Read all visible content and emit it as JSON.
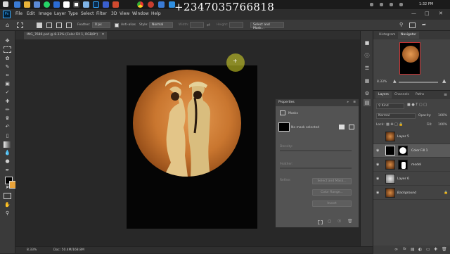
{
  "phone_overlay": "+2347035766818",
  "taskbar": {
    "time": "1:32 PM"
  },
  "menu": [
    "File",
    "Edit",
    "Image",
    "Layer",
    "Type",
    "Select",
    "Filter",
    "3D",
    "View",
    "Window",
    "Help"
  ],
  "options": {
    "feather_label": "Feather:",
    "feather_value": "0 px",
    "antialias": "Anti-alias",
    "style_label": "Style:",
    "style_value": "Normal",
    "width_label": "Width:",
    "height_label": "Height:",
    "select_mask": "Select and Mask..."
  },
  "document": {
    "tab_title": "IMG_7686.psd @ 8.33% (Color Fill 1, RGB/8*)",
    "zoom": "8.33%",
    "doc_info": "Doc: 50.4M/168.8M"
  },
  "properties": {
    "title": "Properties",
    "section": "Masks",
    "no_mask": "No mask selected",
    "density": "Density:",
    "feather": "Feather:",
    "refine": "Refine:",
    "btn_select_mask": "Select and Mask...",
    "btn_color_range": "Color Range...",
    "btn_invert": "Invert"
  },
  "nav_panel": {
    "tabs": [
      "Histogram",
      "Navigator"
    ],
    "zoom": "8.33%"
  },
  "layers_panel": {
    "tabs": [
      "Layers",
      "Channels",
      "Paths"
    ],
    "kind_label": "Kind",
    "blend_mode": "Normal",
    "opacity_label": "Opacity:",
    "opacity_value": "100%",
    "lock_label": "Lock:",
    "fill_label": "Fill:",
    "fill_value": "100%",
    "layers": [
      {
        "name": "Layer 5",
        "italic": false
      },
      {
        "name": "Color Fill 1",
        "italic": false
      },
      {
        "name": "model",
        "italic": false
      },
      {
        "name": "Layer 6",
        "italic": false
      },
      {
        "name": "Background",
        "italic": true
      }
    ]
  },
  "colors": {
    "accent": "#31a8ff",
    "foreground": "#000000",
    "background_swatch": "#e8a33a"
  }
}
